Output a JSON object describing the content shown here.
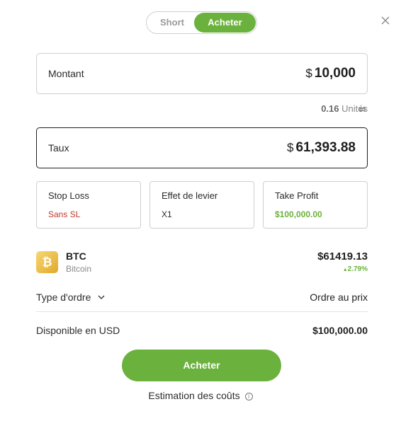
{
  "toggle": {
    "short_label": "Short",
    "buy_label": "Acheter",
    "selected": "Acheter"
  },
  "amount": {
    "label": "Montant",
    "currency": "$",
    "value": "10,000"
  },
  "units": {
    "value": "0.16",
    "label": "Unités"
  },
  "rate": {
    "label": "Taux",
    "currency": "$",
    "value": "61,393.88"
  },
  "cards": {
    "stop_loss": {
      "title": "Stop Loss",
      "value": "Sans SL"
    },
    "leverage": {
      "title": "Effet de levier",
      "value": "X1"
    },
    "take_profit": {
      "title": "Take Profit",
      "value": "$100,000.00"
    }
  },
  "asset": {
    "symbol": "BTC",
    "name": "Bitcoin",
    "icon_glyph": "₿",
    "price": "$61419.13",
    "change": "2.79%",
    "change_arrow": "▲"
  },
  "order_type": {
    "label": "Type d'ordre",
    "value": "Ordre au prix"
  },
  "available": {
    "label": "Disponible en USD",
    "value": "$100,000.00"
  },
  "buy_button": {
    "label": "Acheter"
  },
  "estimate": {
    "label": "Estimation des coûts",
    "info_glyph": "i"
  },
  "colors": {
    "accent_green": "#6bb13d",
    "stop_loss_red": "#c0392b",
    "coin_gold": "#e0a92b"
  }
}
